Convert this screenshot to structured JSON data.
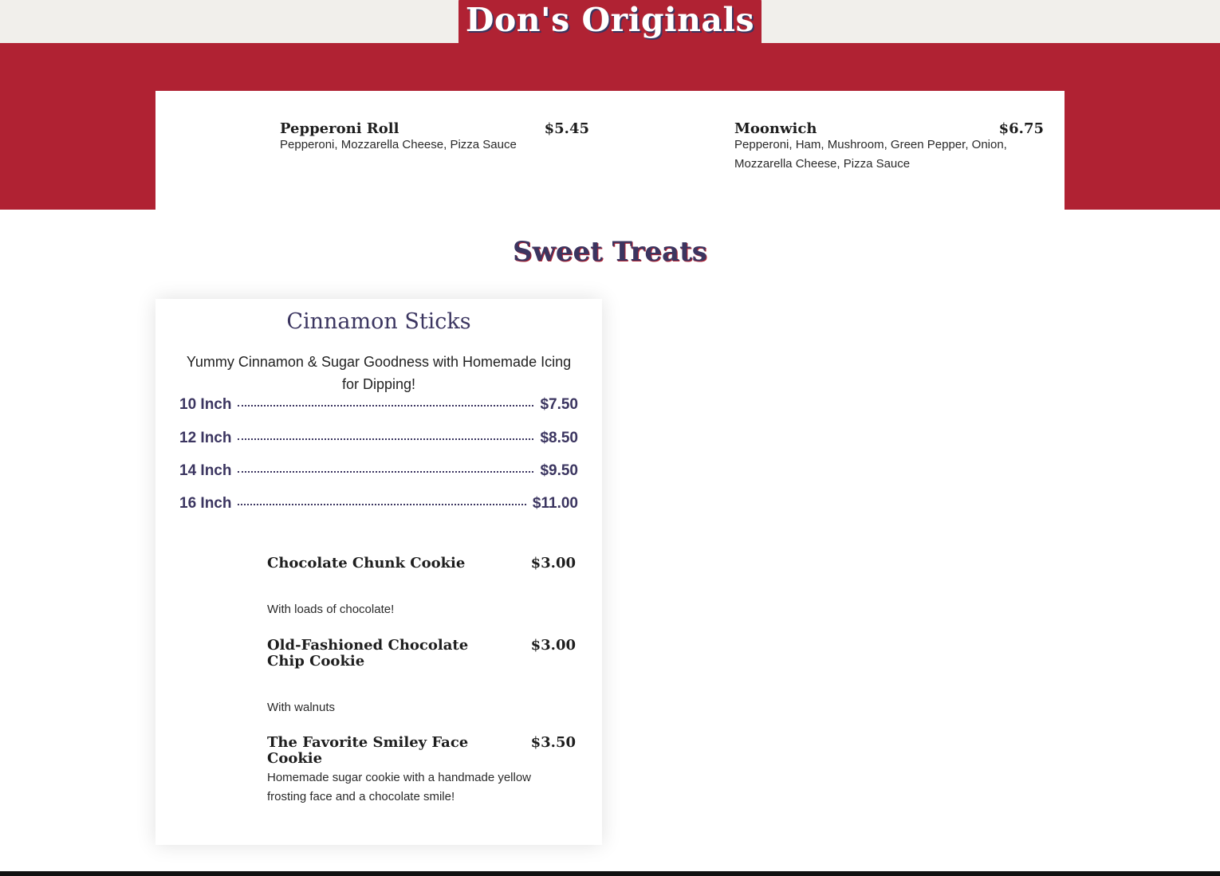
{
  "dons_originals": {
    "title": "Don's Originals",
    "items": [
      {
        "name": "Pepperoni Roll",
        "price": "$5.45",
        "description": "Pepperoni, Mozzarella Cheese, Pizza Sauce"
      },
      {
        "name": "Moonwich",
        "price": "$6.75",
        "description_line1": "Pepperoni, Ham, Mushroom, Green Pepper, Onion,",
        "description_line2": "Mozzarella Cheese, Pizza Sauce"
      }
    ]
  },
  "sweet_treats": {
    "title": "Sweet Treats",
    "cinnamon_sticks": {
      "title": "Cinnamon Sticks",
      "description": "Yummy Cinnamon & Sugar Goodness with Homemade Icing for Dipping!",
      "sizes": [
        {
          "size": "10 Inch",
          "price": "$7.50"
        },
        {
          "size": "12 Inch",
          "price": "$8.50"
        },
        {
          "size": "14 Inch",
          "price": "$9.50"
        },
        {
          "size": "16 Inch",
          "price": "$11.00"
        }
      ]
    },
    "cookies": [
      {
        "name": "Chocolate Chunk Cookie",
        "price": "$3.00",
        "description": "With loads of chocolate!"
      },
      {
        "name": "Old-Fashioned Chocolate Chip Cookie",
        "price": "$3.00",
        "description": "With walnuts"
      },
      {
        "name": "The Favorite Smiley Face Cookie",
        "price": "$3.50",
        "description": "Homemade sugar cookie with a handmade yellow frosting face and a chocolate smile!"
      }
    ]
  },
  "colors": {
    "brand_red": "#b02233",
    "brand_navy": "#3b3560",
    "top_band": "#f1efeb"
  }
}
